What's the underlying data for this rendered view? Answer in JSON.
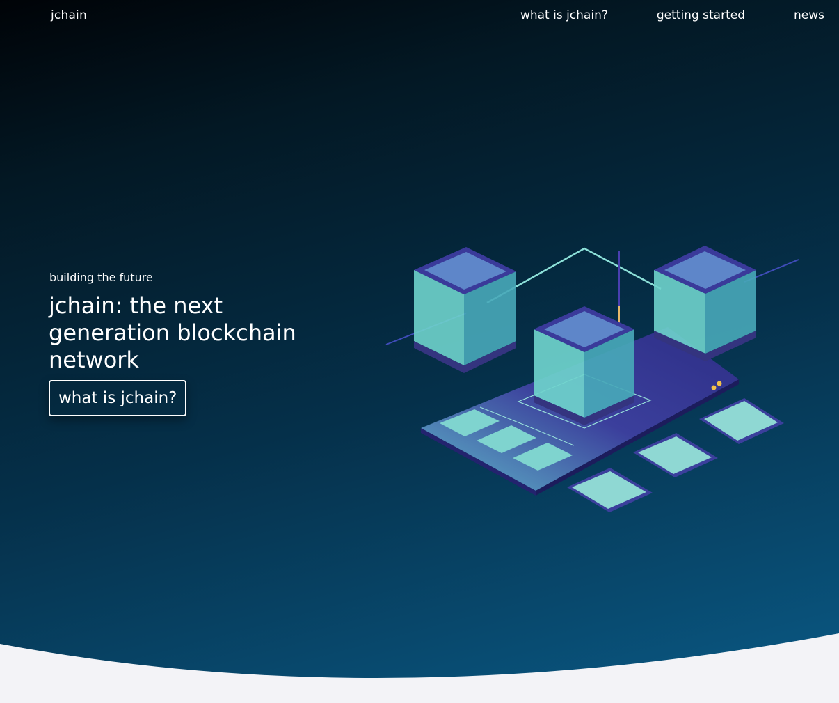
{
  "nav": {
    "brand": "jchain",
    "links": [
      {
        "label": "what is jchain?"
      },
      {
        "label": "getting started"
      },
      {
        "label": "news"
      }
    ]
  },
  "hero": {
    "eyebrow": "building the future",
    "title": "jchain: the next generation blockchain network",
    "cta_label": "what is jchain?"
  },
  "colors": {
    "gradient_top": "#000307",
    "gradient_bottom": "#0a5a86",
    "page_background": "#f3f3f7",
    "accent_teal": "#7fdcd2",
    "accent_indigo": "#3a3a9a"
  },
  "illustration": {
    "icon": "blockchain-servers-illustration"
  }
}
